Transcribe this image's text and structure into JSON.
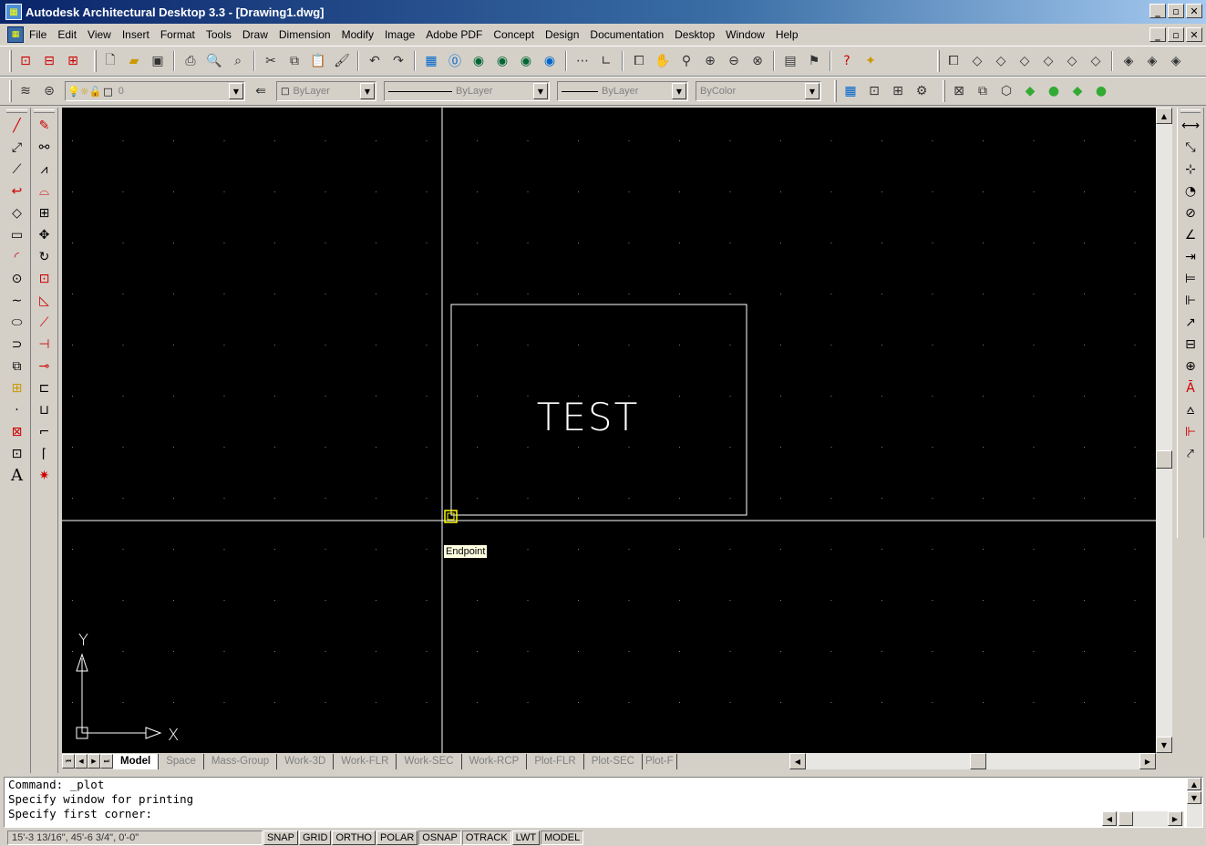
{
  "window": {
    "title": "Autodesk Architectural Desktop 3.3 - [Drawing1.dwg]",
    "minimize": "_",
    "maximize": "▫",
    "close": "✕"
  },
  "menu": {
    "items": [
      "File",
      "Edit",
      "View",
      "Insert",
      "Format",
      "Tools",
      "Draw",
      "Dimension",
      "Modify",
      "Image",
      "Adobe PDF",
      "Concept",
      "Design",
      "Documentation",
      "Desktop",
      "Window",
      "Help"
    ]
  },
  "properties": {
    "layer": "0",
    "color": "ByLayer",
    "linetype": "ByLayer",
    "lineweight": "ByLayer",
    "plotstyle": "ByColor"
  },
  "drawing": {
    "text": "TEST",
    "snap_tooltip": "Endpoint",
    "ucs_y": "Y",
    "ucs_x": "X"
  },
  "tabs": {
    "items": [
      "Model",
      "Space",
      "Mass-Group",
      "Work-3D",
      "Work-FLR",
      "Work-SEC",
      "Work-RCP",
      "Plot-FLR",
      "Plot-SEC",
      "Plot-F"
    ],
    "active": "Model"
  },
  "command": {
    "lines": [
      "Command: _plot",
      "Specify window for printing",
      "Specify first corner:"
    ]
  },
  "status": {
    "coords": "15'-3 13/16\",  45'-6 3/4\",  0'-0\"",
    "buttons": [
      "SNAP",
      "GRID",
      "ORTHO",
      "POLAR",
      "OSNAP",
      "OTRACK",
      "LWT",
      "MODEL"
    ]
  },
  "colors": {
    "canvas": "#000000",
    "crosshair": "#ffffff",
    "snap_marker": "#ffff00",
    "title_active": "#0a246a"
  },
  "icons": {
    "toolbar1": [
      "new-icon",
      "open-icon",
      "save-icon",
      "print-icon",
      "preview-icon",
      "find-icon",
      "cut-icon",
      "copy-icon",
      "paste-icon",
      "match-icon",
      "undo-icon",
      "redo-icon"
    ],
    "draw_toolbar": [
      "line-icon",
      "xline-icon",
      "pline-icon",
      "polygon-icon",
      "rectangle-icon",
      "arc-icon",
      "circle-icon",
      "spline-icon",
      "ellipse-icon",
      "insert-icon",
      "block-icon",
      "point-icon",
      "hatch-icon",
      "region-icon",
      "text-icon"
    ]
  }
}
